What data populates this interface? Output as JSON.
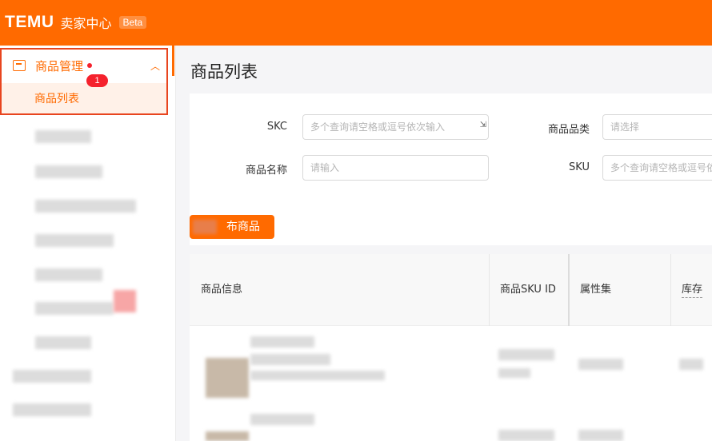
{
  "header": {
    "logo": "TEMU",
    "app_name": "卖家中心",
    "beta_badge": "Beta",
    "colors": {
      "brand": "#ff6a00"
    }
  },
  "sidebar": {
    "group": {
      "label": "商品管理",
      "icon": "box-icon",
      "chevron": "chevron-up-icon",
      "active_item": "商品列表"
    },
    "badge_count": "1"
  },
  "page": {
    "title": "商品列表"
  },
  "filters": {
    "skc": {
      "label": "SKC",
      "placeholder": "多个查询请空格或逗号依次输入"
    },
    "category": {
      "label": "商品品类",
      "placeholder": "请选择"
    },
    "product_name": {
      "label": "商品名称",
      "placeholder": "请输入"
    },
    "sku": {
      "label": "SKU",
      "placeholder": "多个查询请空格或逗号依次输入"
    }
  },
  "actions": {
    "publish_label": "布商品"
  },
  "table": {
    "columns": [
      "商品信息",
      "商品SKU ID",
      "属性集",
      "库存"
    ]
  }
}
